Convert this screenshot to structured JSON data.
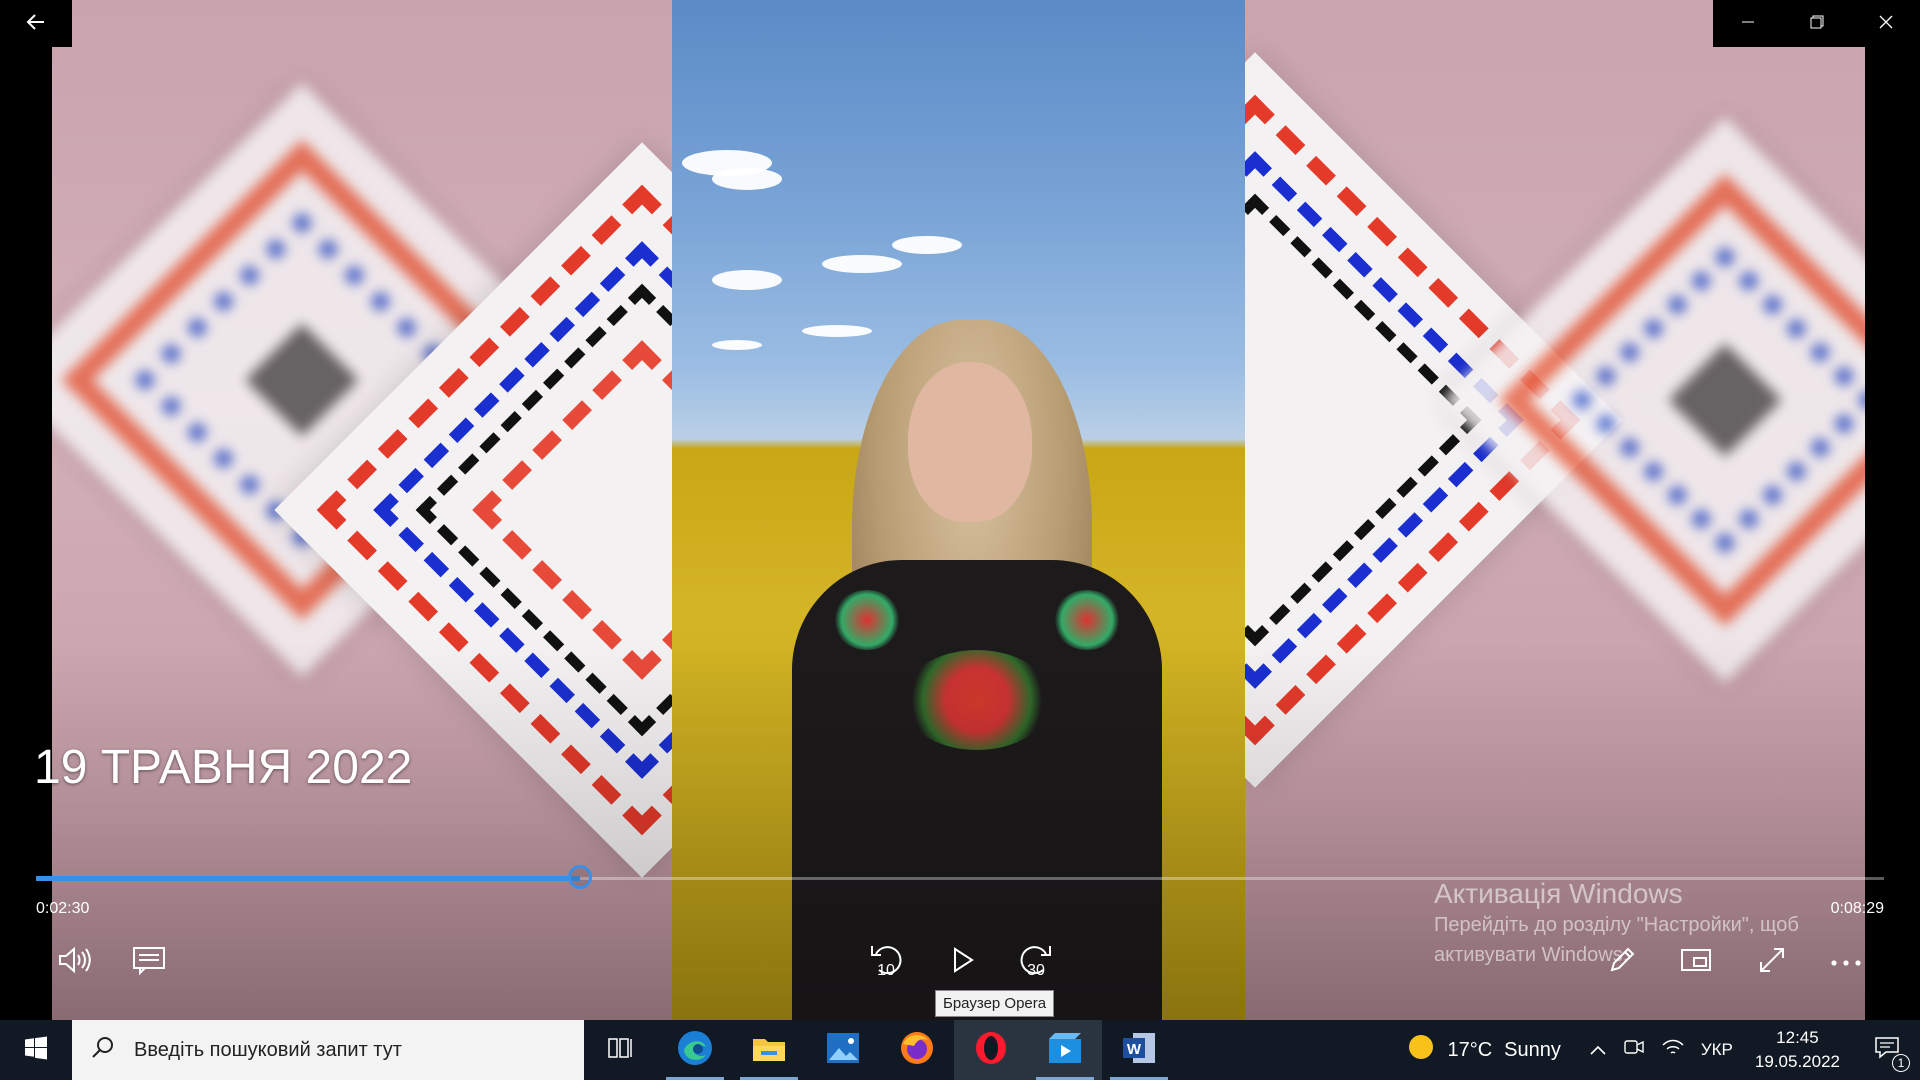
{
  "window": {
    "back_icon": "arrow-left-icon",
    "minimize_icon": "minimize-icon",
    "restore_icon": "restore-icon",
    "close_icon": "close-icon"
  },
  "video": {
    "title": "19 ТРАВНЯ 2022",
    "progress": 0.2946
  },
  "player": {
    "time_current": "0:02:30",
    "time_total": "0:08:29",
    "skip_back": "10",
    "skip_forward": "30",
    "tooltip": "Браузер Opera",
    "accent": "#3a8ee6"
  },
  "activation": {
    "title": "Активація Windows",
    "line1": "Перейдіть до розділу \"Настройки\", щоб",
    "line2": "активувати Windows."
  },
  "taskbar": {
    "search_placeholder": "Введіть пошуковий запит тут",
    "apps": [
      "task-view",
      "edge",
      "file-explorer",
      "photos",
      "firefox",
      "opera",
      "movies-tv",
      "word"
    ]
  },
  "tray": {
    "temperature": "17°C",
    "weather": "Sunny",
    "language": "УКР",
    "time": "12:45",
    "date": "19.05.2022",
    "notifications": "1"
  }
}
